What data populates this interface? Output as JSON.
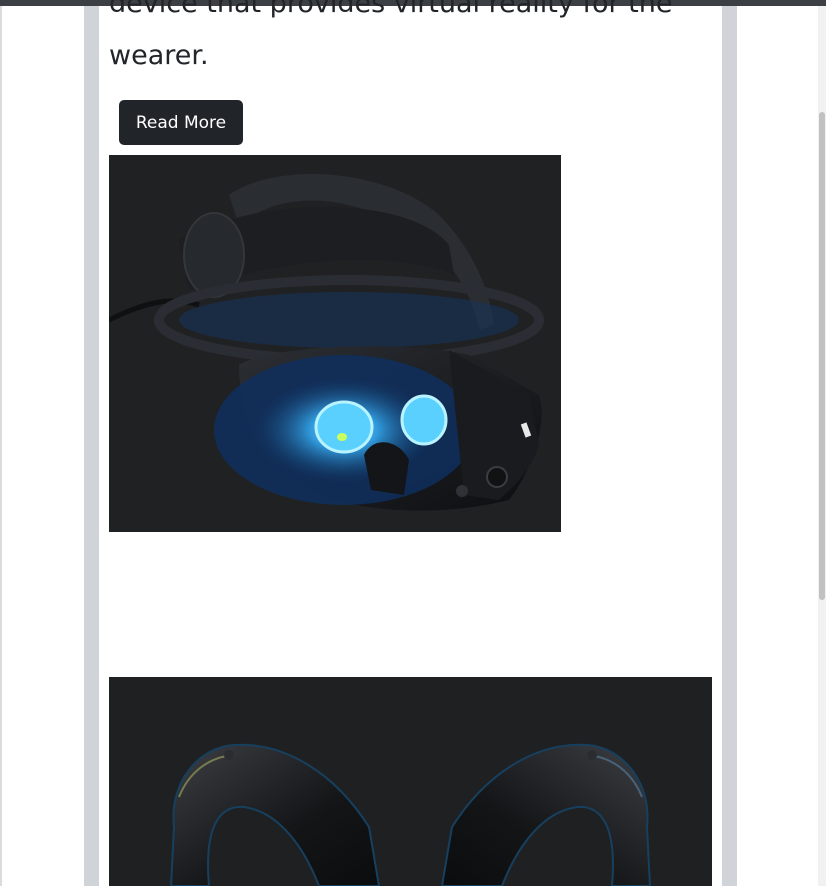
{
  "card": {
    "description_tail": "device that provides virtual reality for the wearer.",
    "read_more_label": "Read More"
  },
  "images": {
    "headset": "vr-headset-image",
    "controllers": "vr-controllers-image"
  }
}
